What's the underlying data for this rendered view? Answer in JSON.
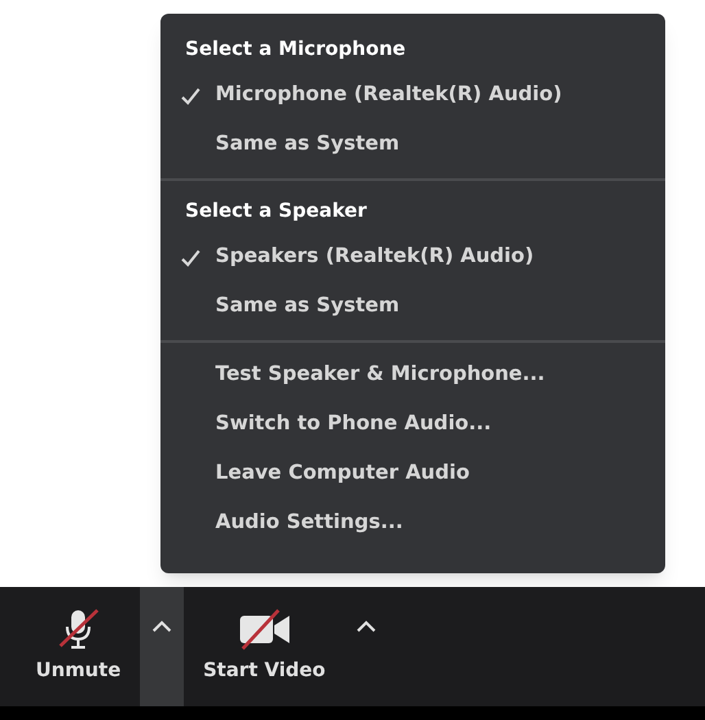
{
  "audio_menu": {
    "sections": [
      {
        "heading": "Select a Microphone",
        "items": [
          {
            "label": "Microphone (Realtek(R) Audio)",
            "checked": true
          },
          {
            "label": "Same as System",
            "checked": false
          }
        ]
      },
      {
        "heading": "Select a Speaker",
        "items": [
          {
            "label": "Speakers (Realtek(R) Audio)",
            "checked": true
          },
          {
            "label": "Same as System",
            "checked": false
          }
        ]
      },
      {
        "items": [
          {
            "label": "Test Speaker & Microphone...",
            "checked": false
          },
          {
            "label": "Switch to Phone Audio...",
            "checked": false
          },
          {
            "label": "Leave Computer Audio",
            "checked": false
          },
          {
            "label": "Audio Settings...",
            "checked": false
          }
        ]
      }
    ]
  },
  "toolbar": {
    "buttons": [
      {
        "kind": "mic",
        "label": "Unmute",
        "off": true,
        "menu_open": true
      },
      {
        "kind": "video",
        "label": "Start Video",
        "off": true,
        "menu_open": false
      }
    ]
  }
}
